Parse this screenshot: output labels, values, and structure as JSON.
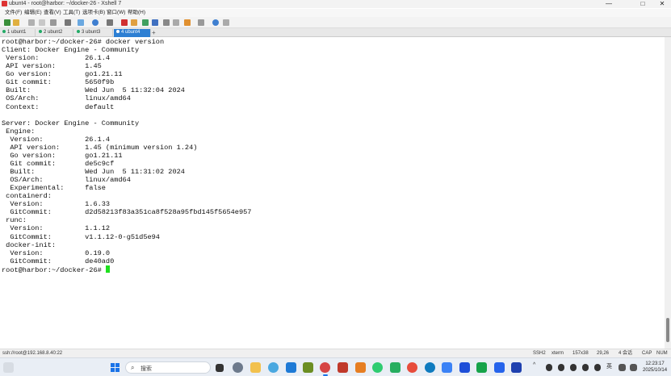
{
  "window": {
    "title": "ubunt4 - root@harbor: ~/docker-26 - Xshell 7",
    "controls": [
      "—",
      "□",
      "✕"
    ]
  },
  "menu": [
    "文件(F)",
    "编辑(E)",
    "查看(V)",
    "工具(T)",
    "选项卡(B)",
    "窗口(W)",
    "帮助(H)"
  ],
  "tabs": [
    {
      "label": "1 ubunt1",
      "active": false
    },
    {
      "label": "2 ubunt2",
      "active": false
    },
    {
      "label": "3 ubunt3",
      "active": false
    },
    {
      "label": "4 ubunt4",
      "active": true
    }
  ],
  "new_tab_label": "+",
  "terminal": {
    "lines": [
      "root@harbor:~/docker-26# docker version",
      "Client: Docker Engine - Community",
      " Version:           26.1.4",
      " API version:       1.45",
      " Go version:        go1.21.11",
      " Git commit:        5650f9b",
      " Built:             Wed Jun  5 11:32:04 2024",
      " OS/Arch:           linux/amd64",
      " Context:           default",
      "",
      "Server: Docker Engine - Community",
      " Engine:",
      "  Version:          26.1.4",
      "  API version:      1.45 (minimum version 1.24)",
      "  Go version:       go1.21.11",
      "  Git commit:       de5c9cf",
      "  Built:            Wed Jun  5 11:31:02 2024",
      "  OS/Arch:          linux/amd64",
      "  Experimental:     false",
      " containerd:",
      "  Version:          1.6.33",
      "  GitCommit:        d2d58213f83a351ca8f528a95fbd145f5654e957",
      " runc:",
      "  Version:          1.1.12",
      "  GitCommit:        v1.1.12-0-g51d5e94",
      " docker-init:",
      "  Version:          0.19.0",
      "  GitCommit:        de40ad0"
    ],
    "prompt": "root@harbor:~/docker-26# ",
    "cursor_color": "#1ee01e"
  },
  "status": {
    "connection": "ssh://root@192.168.8.40:22",
    "protocol": "SSH2",
    "term": "xterm",
    "size": "157x38",
    "position": "29,26",
    "sessions": "4 会话",
    "caps": "CAP",
    "num": "NUM"
  },
  "taskbar": {
    "search_placeholder": "搜索",
    "ime": "英",
    "time": "12:23:17",
    "date": "2025/10/14"
  },
  "colors": {
    "active_tab": "#2d7fd3",
    "cursor": "#1ee01e",
    "taskbar": "#e9eef5"
  }
}
